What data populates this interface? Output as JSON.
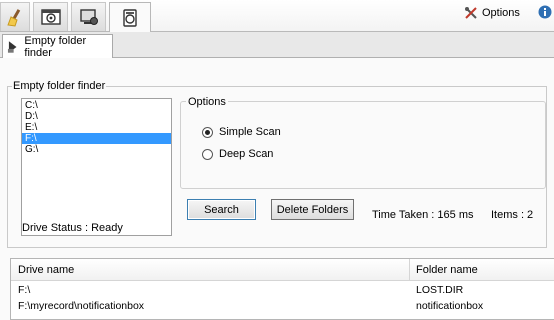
{
  "toolbar": {
    "tools": [
      {
        "icon": "broom-icon",
        "active": false
      },
      {
        "icon": "film-window-icon",
        "active": false
      },
      {
        "icon": "monitor-disk-icon",
        "active": false
      },
      {
        "icon": "folder-disk-icon",
        "active": true
      }
    ],
    "options_label": "Options",
    "info_icon": "info-icon"
  },
  "subtab": {
    "label": "Empty folder finder",
    "icon": "folder-arrow-icon"
  },
  "group": {
    "title": "Empty folder finder"
  },
  "drives": {
    "items": [
      "C:\\",
      "D:\\",
      "E:\\",
      "F:\\",
      "G:\\"
    ],
    "selected": "F:\\"
  },
  "options": {
    "title": "Options",
    "simple_label": "Simple Scan",
    "deep_label": "Deep Scan",
    "selected": "Simple Scan"
  },
  "buttons": {
    "search": "Search",
    "delete": "Delete Folders"
  },
  "status": {
    "drive_status": "Drive Status : Ready",
    "time_taken": "Time Taken : 165 ms",
    "items": "Items : 2"
  },
  "results": {
    "columns": [
      "Drive name",
      "Folder name"
    ],
    "rows": [
      [
        "F:\\",
        "LOST.DIR"
      ],
      [
        "F:\\myrecord\\notificationbox",
        "notificationbox"
      ]
    ]
  },
  "colors": {
    "selection": "#3399ff",
    "accent_button_border": "#3c7fb1"
  }
}
